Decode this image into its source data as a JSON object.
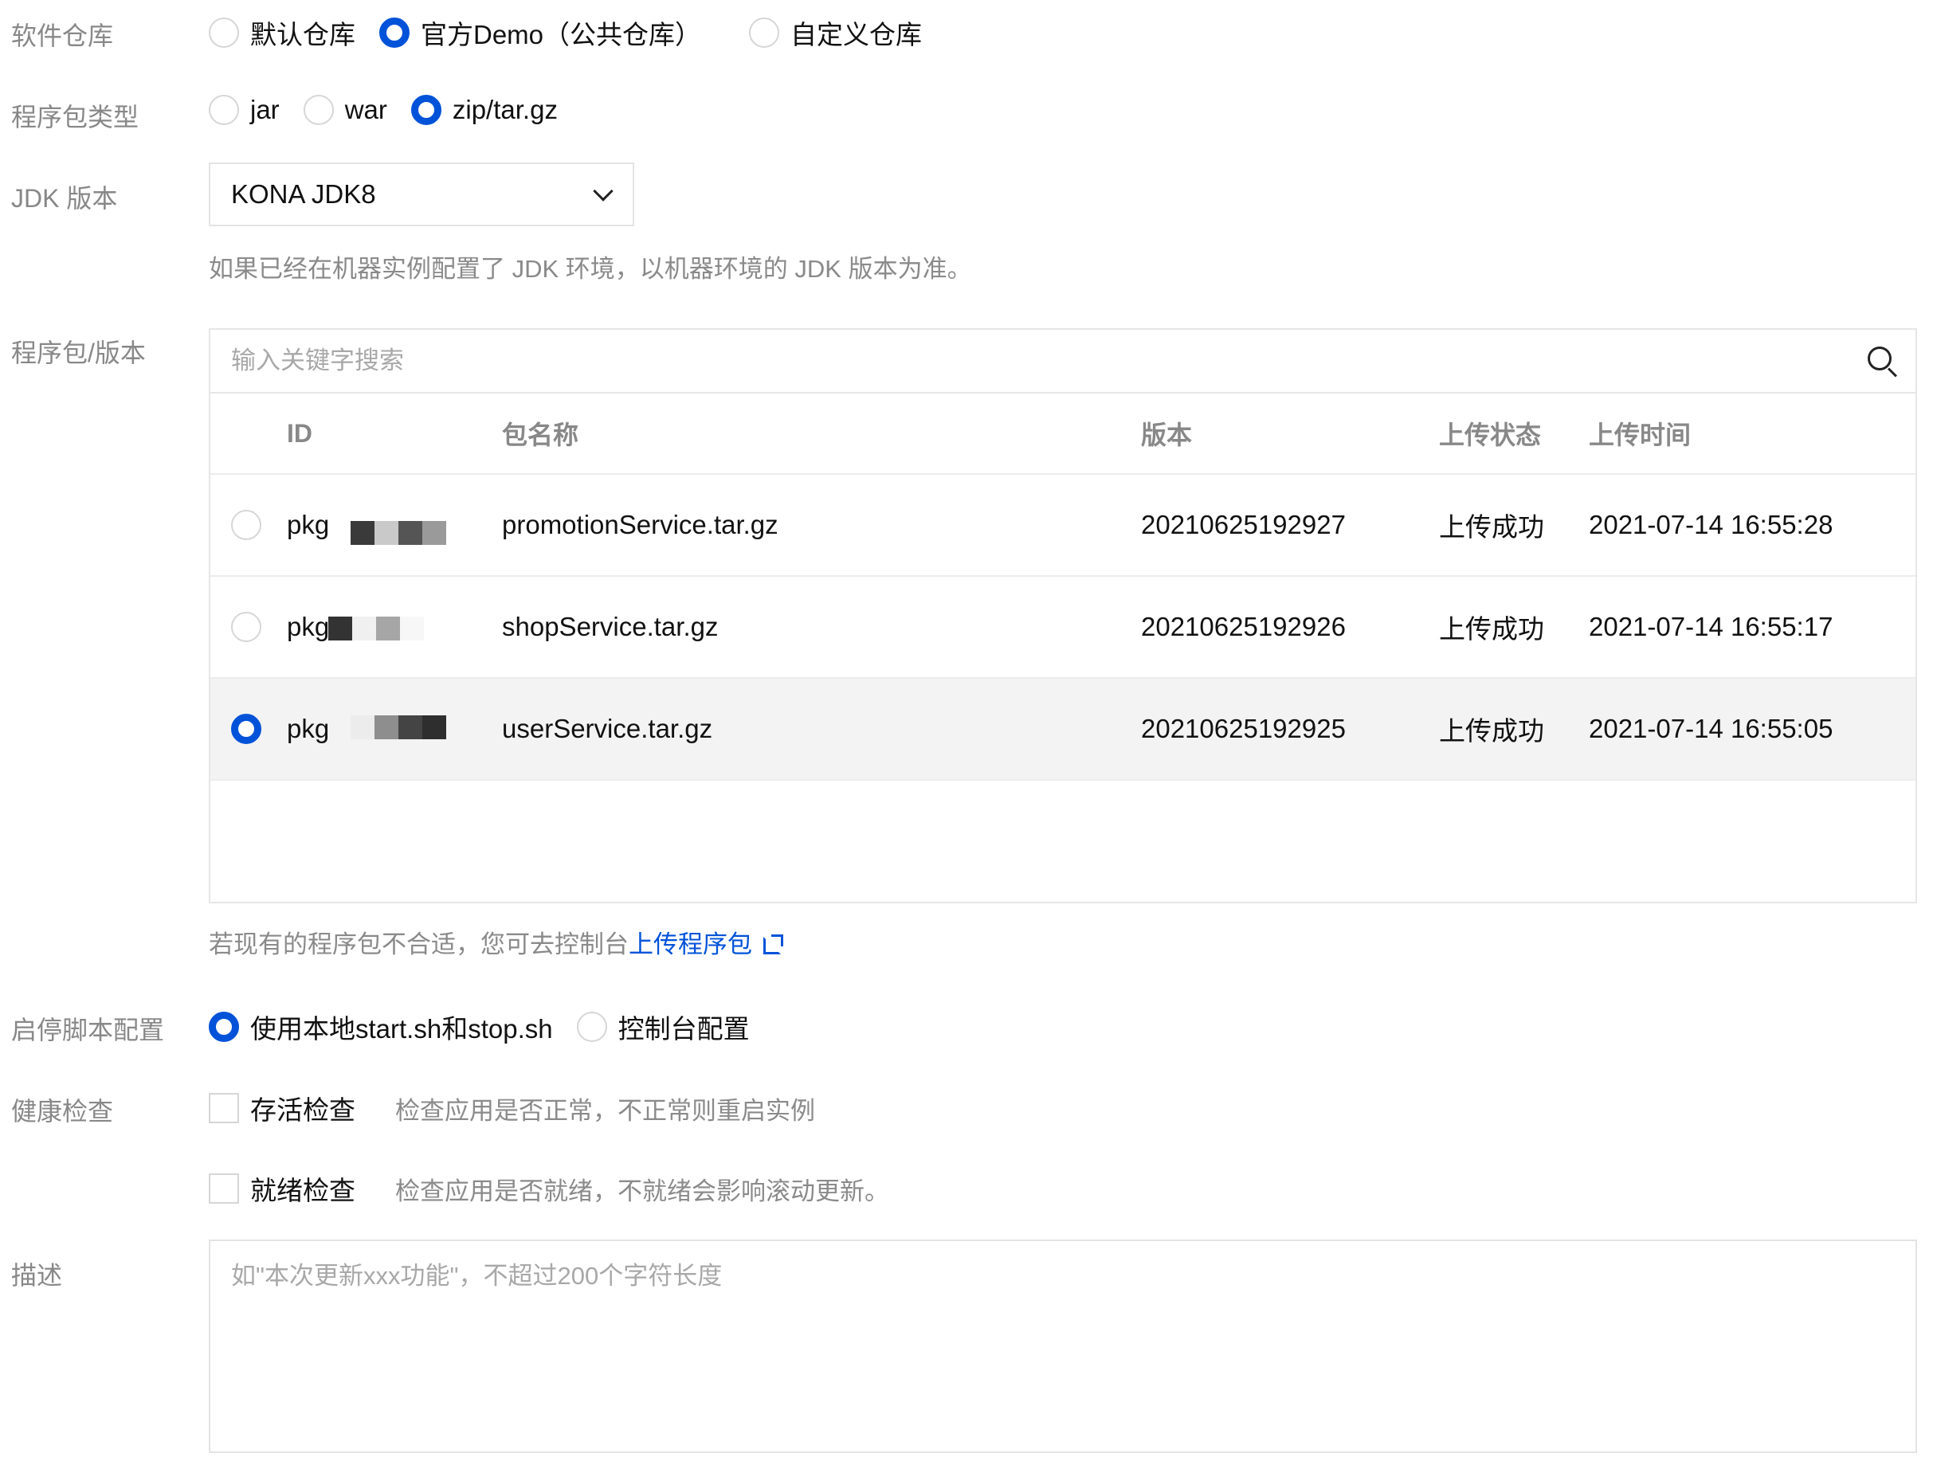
{
  "repo": {
    "label": "软件仓库",
    "options": [
      "默认仓库",
      "官方Demo（公共仓库）",
      "自定义仓库"
    ],
    "selected_index": 1
  },
  "package_type": {
    "label": "程序包类型",
    "options": [
      "jar",
      "war",
      "zip/tar.gz"
    ],
    "selected_index": 2
  },
  "jdk": {
    "label": "JDK 版本",
    "value": "KONA JDK8",
    "hint": "如果已经在机器实例配置了 JDK 环境，以机器环境的 JDK 版本为准。"
  },
  "package_version": {
    "label": "程序包/版本",
    "search_placeholder": "输入关键字搜索",
    "columns": [
      "ID",
      "包名称",
      "版本",
      "上传状态",
      "上传时间"
    ],
    "rows": [
      {
        "id": "pkg",
        "name": "promotionService.tar.gz",
        "version": "20210625192927",
        "status": "上传成功",
        "time": "2021-07-14 16:55:28",
        "selected": false
      },
      {
        "id": "pkg",
        "name": "shopService.tar.gz",
        "version": "20210625192926",
        "status": "上传成功",
        "time": "2021-07-14 16:55:17",
        "selected": false
      },
      {
        "id": "pkg",
        "name": "userService.tar.gz",
        "version": "20210625192925",
        "status": "上传成功",
        "time": "2021-07-14 16:55:05",
        "selected": true
      }
    ],
    "upload_hint_prefix": "若现有的程序包不合适，您可去控制台",
    "upload_link": "上传程序包"
  },
  "start_stop": {
    "label": "启停脚本配置",
    "options": [
      "使用本地start.sh和stop.sh",
      "控制台配置"
    ],
    "selected_index": 0
  },
  "health": {
    "label": "健康检查",
    "liveness": {
      "label": "存活检查",
      "desc": "检查应用是否正常，不正常则重启实例",
      "checked": false
    },
    "readiness": {
      "label": "就绪检查",
      "desc": "检查应用是否就绪，不就绪会影响滚动更新。",
      "checked": false
    }
  },
  "description": {
    "label": "描述",
    "placeholder": "如\"本次更新xxx功能\"，不超过200个字符长度"
  },
  "colors": {
    "accent": "#0052d9",
    "label_gray": "#888888",
    "selected_row": "#f3f3f3"
  }
}
